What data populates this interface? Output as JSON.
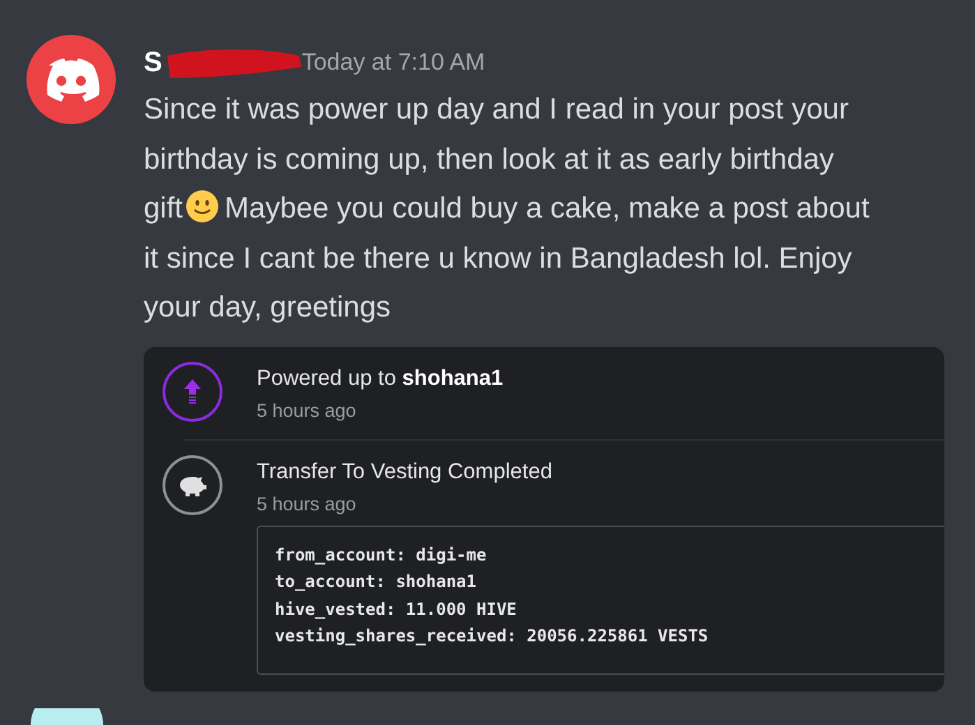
{
  "message": {
    "author": "S",
    "timestamp": "Today at 7:10 AM",
    "segments": [
      {
        "kind": "text",
        "text": "Since it was power up day and I read in your post your\nbirthday is coming up, then look at it as early birthday\ngift"
      },
      {
        "kind": "emoji"
      },
      {
        "kind": "text",
        "text": "Maybee you could buy a cake, make a post about\nit since I cant be there u know in Bangladesh lol. Enjoy\nyour day, greetings"
      }
    ]
  },
  "embed": {
    "items": [
      {
        "kind": "power-up",
        "title": "Powered up to **shohana1**",
        "time": "5 hours ago"
      },
      {
        "kind": "vesting",
        "title": "Transfer To Vesting Completed",
        "time": "5 hours ago",
        "details": [
          "from_account: digi-me",
          "to_account: shohana1",
          "hive_vested: 11.000 HIVE",
          "vesting_shares_received: 20056.225861 VESTS"
        ]
      }
    ]
  }
}
